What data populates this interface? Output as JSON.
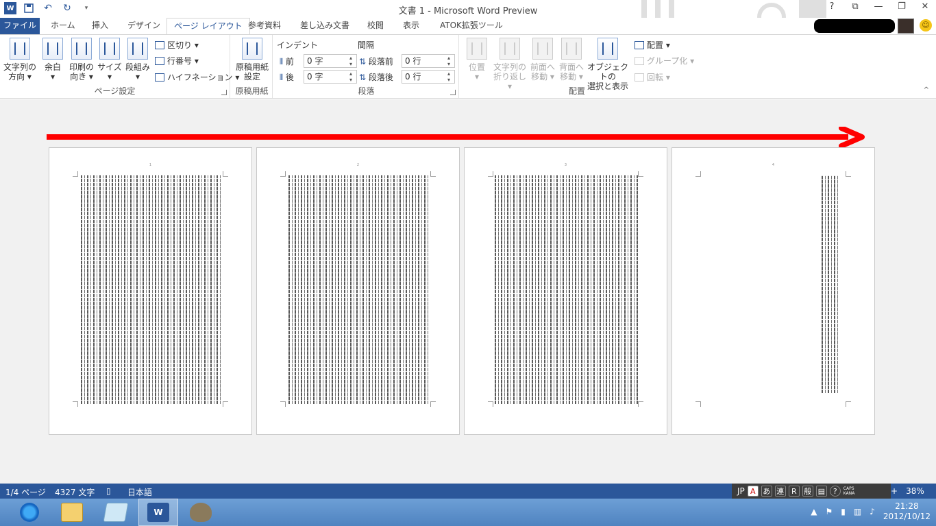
{
  "window": {
    "title": "文書 1 - Microsoft Word Preview",
    "help": "?",
    "restore": "⧉",
    "minimize": "—",
    "maximize": "❐",
    "close": "✕"
  },
  "qat": {
    "app_icon": "W",
    "save_icon": "save-icon",
    "undo": "↶",
    "redo": "↻",
    "customize": "▾"
  },
  "tabs": [
    {
      "label": "ファイル"
    },
    {
      "label": "ホーム"
    },
    {
      "label": "挿入"
    },
    {
      "label": "デザイン"
    },
    {
      "label": "ページ レイアウト"
    },
    {
      "label": "参考資料"
    },
    {
      "label": "差し込み文書"
    },
    {
      "label": "校閲"
    },
    {
      "label": "表示"
    },
    {
      "label": "ATOK拡張ツール"
    }
  ],
  "ribbon": {
    "page_setup": {
      "label": "ページ設定",
      "text_direction": "文字列の\n方向 ▾",
      "margins": "余白\n▾",
      "orientation": "印刷の\n向き ▾",
      "size": "サイズ\n▾",
      "columns": "段組み\n▾",
      "breaks": "区切り ▾",
      "line_numbers": "行番号 ▾",
      "hyphenation": "ハイフネーション ▾"
    },
    "manuscript": {
      "label": "原稿用紙",
      "button": "原稿用紙\n設定"
    },
    "paragraph": {
      "label": "段落",
      "indent_heading": "インデント",
      "spacing_heading": "間隔",
      "indent_before_label": "前",
      "indent_before_value": "0 字",
      "indent_after_label": "後",
      "indent_after_value": "0 字",
      "space_before_label": "段落前",
      "space_before_value": "0 行",
      "space_after_label": "段落後",
      "space_after_value": "0 行"
    },
    "arrange": {
      "label": "配置",
      "position": "位置\n▾",
      "wrap_text": "文字列の\n折り返し ▾",
      "bring_forward": "前面へ\n移動 ▾",
      "send_backward": "背面へ\n移動 ▾",
      "selection_pane": "オブジェクトの\n選択と表示",
      "align": "配置 ▾",
      "group": "グループ化 ▾",
      "rotate": "回転 ▾"
    },
    "collapse": "^"
  },
  "pages": [
    {
      "number": "1"
    },
    {
      "number": "2"
    },
    {
      "number": "3"
    },
    {
      "number": "4"
    }
  ],
  "status": {
    "page": "1/4 ページ",
    "words": "4327 文字",
    "language": "日本語",
    "zoom": "38%",
    "zoom_in": "+"
  },
  "ime": {
    "mode": "JP",
    "a": "A",
    "kana": "あ",
    "ren": "連",
    "r": "R",
    "han": "般",
    "caps": "CAPS\nKANA"
  },
  "taskbar": {
    "time": "21:28",
    "date": "2012/10/12"
  },
  "colors": {
    "accent": "#2b579a",
    "arrow": "#ff0000"
  }
}
